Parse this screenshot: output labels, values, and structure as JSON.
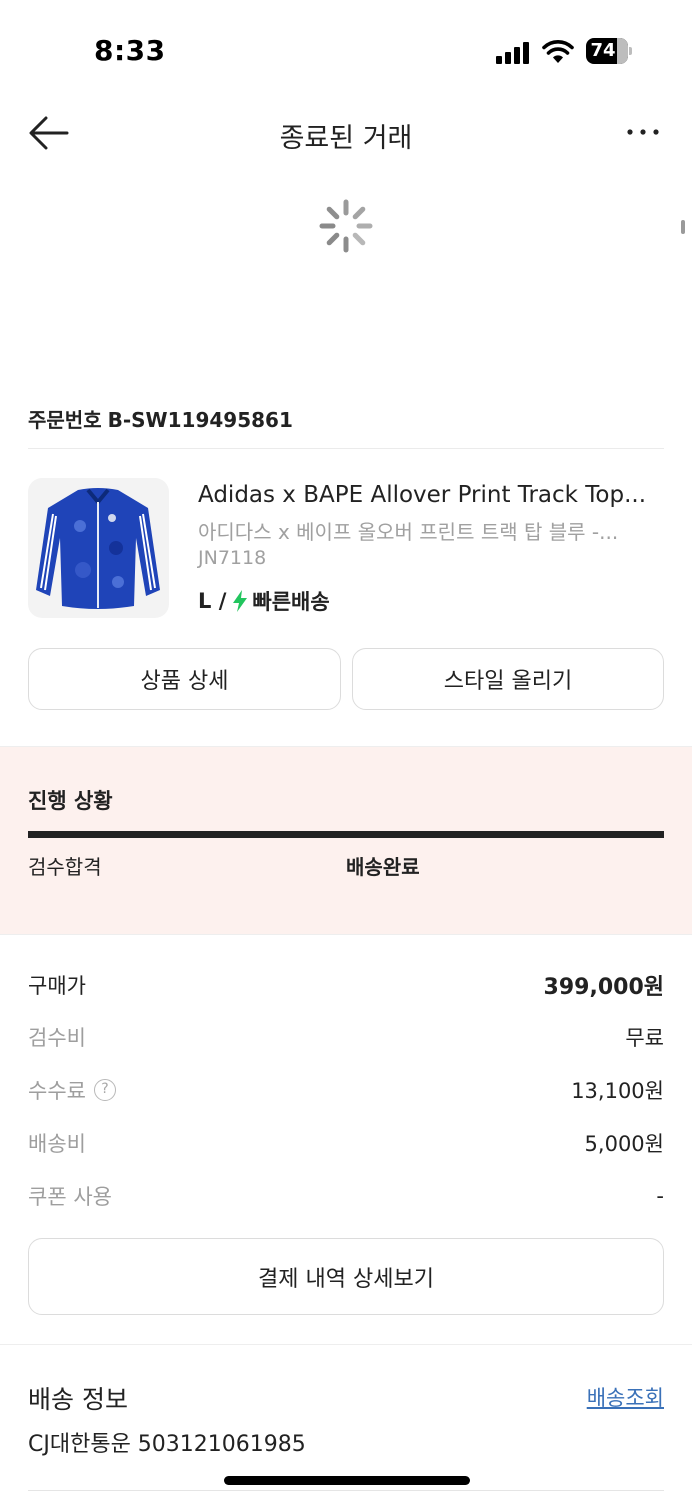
{
  "status_bar": {
    "time": "8:33",
    "battery": "74"
  },
  "header": {
    "title": "종료된 거래"
  },
  "order": {
    "label": "주문번호",
    "number": "B-SW119495861"
  },
  "product": {
    "name_en": "Adidas x BAPE Allover Print Track Top...",
    "name_ko": "아디다스 x 베이프 올오버 프린트 트랙 탑 블루 -...",
    "code": "JN7118",
    "size": "L /",
    "shipping": "빠른배송",
    "bolt_color": "#22c55e"
  },
  "actions": {
    "detail_label": "상품 상세",
    "style_label": "스타일 올리기"
  },
  "progress": {
    "title": "진행 상황",
    "step1": "검수합격",
    "step2": "배송완료",
    "fill_fraction": 1.0,
    "background": "#fdf1ee"
  },
  "price": {
    "rows": [
      {
        "label": "구매가",
        "value": "399,000원"
      },
      {
        "label": "검수비",
        "value": "무료"
      },
      {
        "label": "수수료",
        "value": "13,100원"
      },
      {
        "label": "배송비",
        "value": "5,000원"
      },
      {
        "label": "쿠폰 사용",
        "value": "-"
      }
    ],
    "payment_button": "결제 내역 상세보기"
  },
  "delivery": {
    "title": "배송 정보",
    "link_label": "배송조회",
    "tracking": "CJ대한통운 503121061985",
    "link_color": "#3a71b8"
  }
}
